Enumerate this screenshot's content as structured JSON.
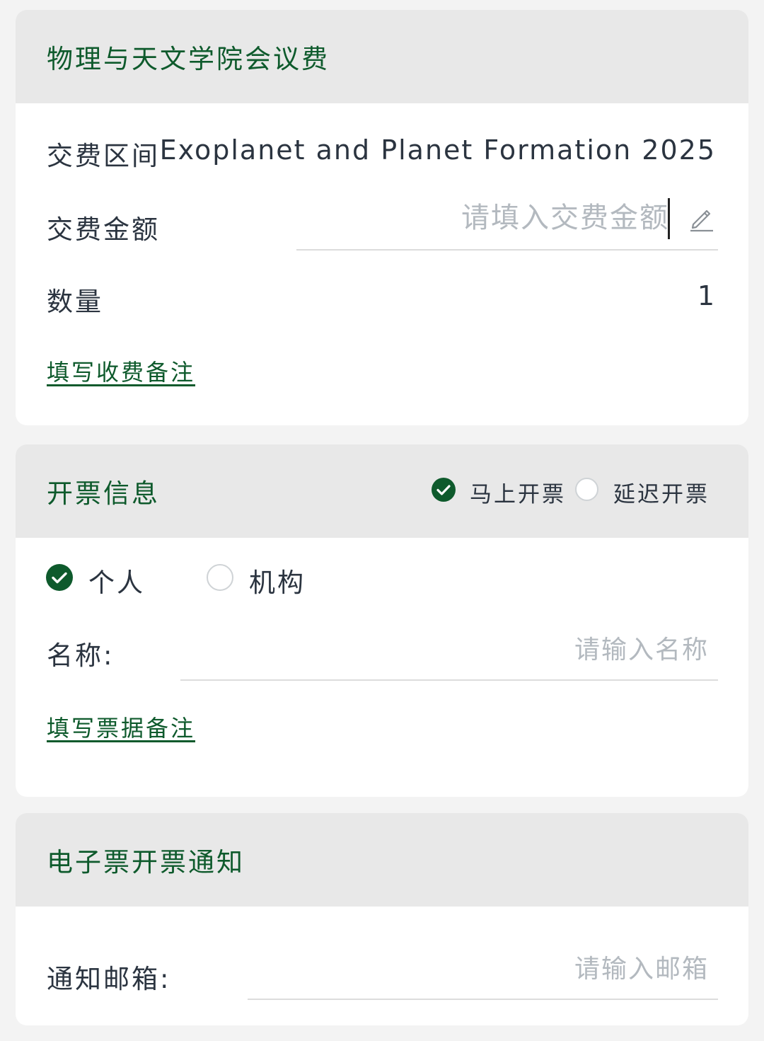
{
  "fee_card": {
    "title": "物理与天文学院会议费",
    "period_label": "交费区间",
    "period_value": "Exoplanet and Planet Formation 2025",
    "amount_label": "交费金额",
    "amount_placeholder": "请填入交费金额",
    "quantity_label": "数量",
    "quantity_value": "1",
    "remark_link": "填写收费备注"
  },
  "invoice_card": {
    "title": "开票信息",
    "timing_options": [
      {
        "label": "马上开票",
        "selected": true
      },
      {
        "label": "延迟开票",
        "selected": false
      }
    ],
    "type_options": [
      {
        "label": "个人",
        "selected": true
      },
      {
        "label": "机构",
        "selected": false
      }
    ],
    "name_label": "名称:",
    "name_placeholder": "请输入名称",
    "remark_link": "填写票据备注"
  },
  "notify_card": {
    "title": "电子票开票通知",
    "email_label": "通知邮箱:",
    "email_placeholder": "请输入邮箱"
  },
  "colors": {
    "accent": "#0e5a2c",
    "header_bg": "#e8e8e8",
    "page_bg": "#f3f3f3",
    "placeholder": "#b3b9bf",
    "text": "#2b3440"
  },
  "icons": {
    "checked": "check-circle-icon",
    "unchecked": "empty-circle-icon",
    "edit": "pencil-icon"
  }
}
